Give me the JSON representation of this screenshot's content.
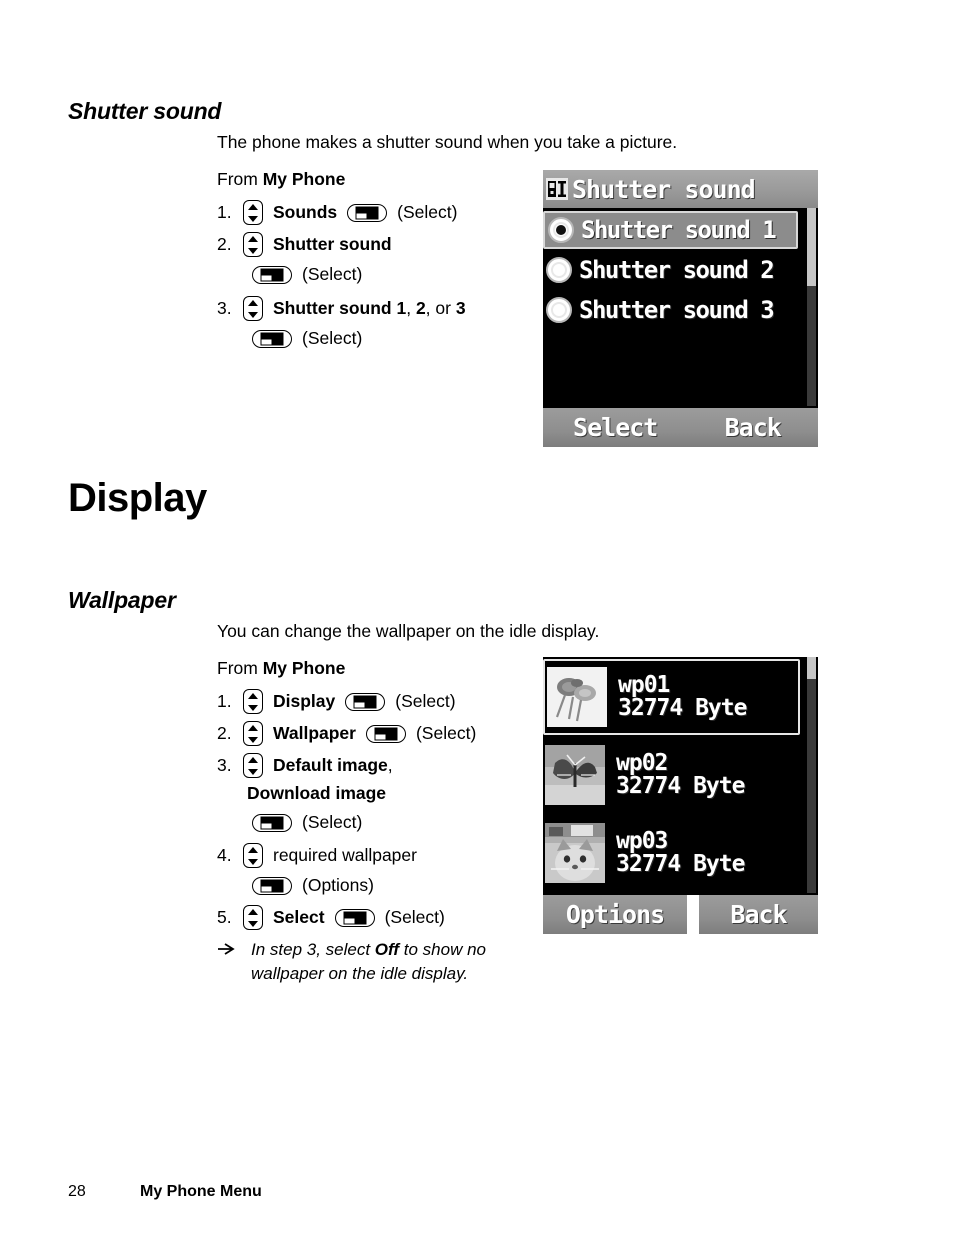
{
  "page": {
    "number": "28",
    "footer_title": "My Phone Menu"
  },
  "sections": [
    {
      "heading": "Shutter sound",
      "intro": "The phone makes a shutter sound when you take a picture.",
      "from_prefix": "From ",
      "from_menu": "My Phone",
      "steps": [
        {
          "num": "1.",
          "label": "Sounds",
          "action": "(Select)"
        },
        {
          "num": "2.",
          "label": "Shutter sound",
          "action": "(Select)"
        },
        {
          "num": "3.",
          "label": "Shutter sound 1, 2, or 3",
          "action": "(Select)"
        }
      ]
    },
    {
      "heading": "Display"
    },
    {
      "heading": "Wallpaper",
      "intro": "You can change the wallpaper on the idle display.",
      "from_prefix": "From ",
      "from_menu": "My Phone",
      "steps": [
        {
          "num": "1.",
          "label": "Display",
          "action": "(Select)"
        },
        {
          "num": "2.",
          "label": "Wallpaper",
          "action": "(Select)"
        },
        {
          "num": "3.",
          "label": "Default image, Download image",
          "action": "(Select)"
        },
        {
          "num": "4.",
          "label": "required wallpaper",
          "action": "(Options)"
        },
        {
          "num": "5.",
          "label": "Select",
          "action": "(Select)"
        }
      ],
      "note": {
        "pre": "In step 3, select ",
        "emphasis": "Off",
        "post": " to show no wallpaper on the idle display."
      }
    }
  ],
  "step_text": {
    "s1_num": "1.",
    "s1_label": "Sounds",
    "s1_action": "(Select)",
    "s2_num": "2.",
    "s2_label": "Shutter sound",
    "s2_action": "(Select)",
    "s3_num": "3.",
    "s3_label_a": "Shutter sound ",
    "s3_label_1": "1",
    "s3_sep1": ", ",
    "s3_label_2": "2",
    "s3_sep2": ", or ",
    "s3_label_3": "3",
    "s3_action": "(Select)",
    "w1_num": "1.",
    "w1_label": "Display",
    "w1_action": "(Select)",
    "w2_num": "2.",
    "w2_label": "Wallpaper",
    "w2_action": "(Select)",
    "w3_num": "3.",
    "w3_label_a": "Default image",
    "w3_comma": ",",
    "w3_label_b": "Download image",
    "w3_action": "(Select)",
    "w4_num": "4.",
    "w4_label": "required wallpaper",
    "w4_action": "(Options)",
    "w5_num": "5.",
    "w5_label": "Select",
    "w5_action": "(Select)"
  },
  "phone_shutter": {
    "title": "Shutter sound",
    "title_icon": "phone-tone-icon",
    "items": [
      {
        "label": "Shutter sound 1",
        "selected": true
      },
      {
        "label": "Shutter sound 2",
        "selected": false
      },
      {
        "label": "Shutter sound 3",
        "selected": false
      }
    ],
    "softkey_left": "Select",
    "softkey_right": "Back"
  },
  "phone_wallpaper": {
    "items": [
      {
        "name": "wp01",
        "size": "32774 Byte",
        "thumb": "flowers-thumbnail",
        "selected": true
      },
      {
        "name": "wp02",
        "size": "32774 Byte",
        "thumb": "butterfly-thumbnail",
        "selected": false
      },
      {
        "name": "wp03",
        "size": "32774 Byte",
        "thumb": "animal-thumbnail",
        "selected": false
      }
    ],
    "softkey_left": "Options",
    "softkey_right": "Back"
  },
  "headings": {
    "shutter_sound": "Shutter sound",
    "display": "Display",
    "wallpaper": "Wallpaper"
  },
  "common": {
    "from_prefix": "From ",
    "from_menu": "My Phone",
    "intro_shutter": "The phone makes a shutter sound when you take a picture.",
    "intro_wallpaper": "You can change the wallpaper on the idle display.",
    "note_pre": "In step 3, select ",
    "note_em": "Off",
    "note_post": " to show no",
    "note_line2": "wallpaper on the idle display."
  },
  "colors": {
    "screen_bg": "#000000",
    "titlebar": "#9a9a9a",
    "softkey": "#8e8e8e",
    "highlight": "#8c8c8c",
    "text_white": "#ffffff"
  }
}
